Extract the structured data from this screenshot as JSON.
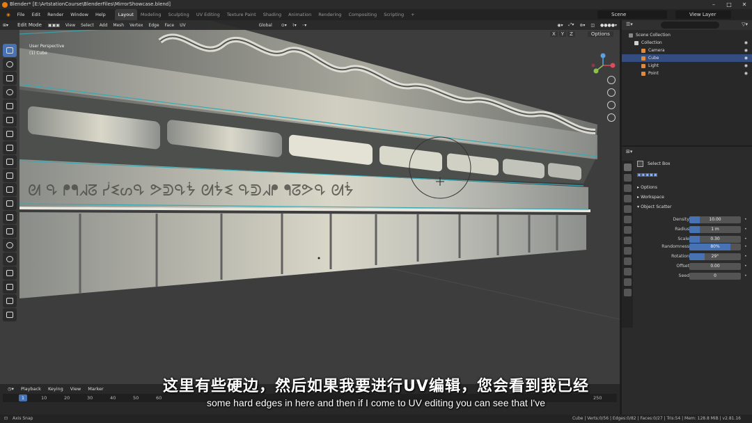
{
  "window": {
    "title": "Blender* [E:\\ArtstationCourse\\BlenderFiles\\MirrorShowcase.blend]"
  },
  "menu": [
    "File",
    "Edit",
    "Render",
    "Window",
    "Help"
  ],
  "workspaces": [
    "Layout",
    "Modeling",
    "Sculpting",
    "UV Editing",
    "Texture Paint",
    "Shading",
    "Animation",
    "Rendering",
    "Compositing",
    "Scripting",
    "+"
  ],
  "active_workspace": "Layout",
  "scene": "Scene",
  "view_layer": "View Layer",
  "viewport": {
    "mode": "Edit Mode",
    "menus": [
      "View",
      "Select",
      "Add",
      "Mesh",
      "Vertex",
      "Edge",
      "Face",
      "UV"
    ],
    "orientation": "Global",
    "options_label": "Options",
    "axes": [
      "X",
      "Y",
      "Z"
    ],
    "overlay_line1": "User Perspective",
    "overlay_line2": "(1) Cube"
  },
  "subtitle": {
    "chinese": "这里有些硬边，然后如果我要进行UV编辑，您会看到我已经",
    "english": "some hard edges in here and then if I come to UV editing you can see that I've"
  },
  "timeline": {
    "menus": [
      "Playback",
      "Keying",
      "View",
      "Marker"
    ],
    "current_frame": "1",
    "ticks": [
      "10",
      "20",
      "30",
      "40",
      "50",
      "60",
      "250"
    ]
  },
  "statusbar": {
    "left": "Axis Snap",
    "right": "Cube | Verts:0/56 | Edges:0/82 | Faces:0/27 | Tris:54 | Mem: 128.8 MiB | v2.81.16"
  },
  "outliner": {
    "root": "Scene Collection",
    "rows": [
      {
        "label": "Collection",
        "color": "#d0d0d0",
        "selected": false
      },
      {
        "label": "Camera",
        "color": "#e08a3c",
        "selected": false
      },
      {
        "label": "Cube",
        "color": "#e08a3c",
        "selected": true
      },
      {
        "label": "Light",
        "color": "#e08a3c",
        "selected": false
      },
      {
        "label": "Point",
        "color": "#e08a3c",
        "selected": false
      }
    ]
  },
  "properties": {
    "tool": "Select Box",
    "sections": [
      "Options",
      "Workspace",
      "Object Scatter"
    ],
    "fields": [
      {
        "label": "Density",
        "value": "10.00",
        "fill": 0.2
      },
      {
        "label": "Radius",
        "value": "1 m",
        "fill": 0.2
      },
      {
        "label": "Scale",
        "value": "0.30",
        "fill": 0.2
      },
      {
        "label": "Randomness",
        "value": "80%",
        "fill": 0.8
      },
      {
        "label": "Rotation",
        "value": "29°",
        "fill": 0.3
      },
      {
        "label": "Offset",
        "value": "0.00",
        "fill": 0.0
      },
      {
        "label": "Seed",
        "value": "0",
        "fill": 0.0
      }
    ]
  }
}
